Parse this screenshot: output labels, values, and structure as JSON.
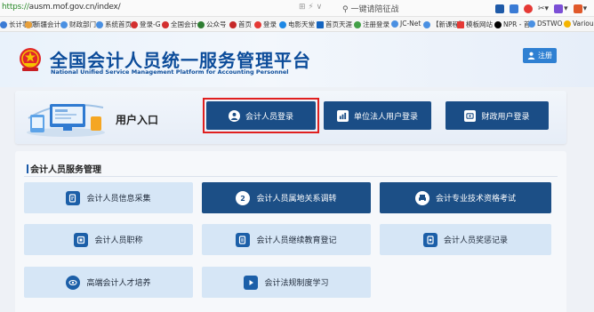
{
  "browser": {
    "url_scheme": "https://",
    "url_rest": "ausm.mof.gov.cn/index/",
    "address_icons": "⊞ ⚡ ∨",
    "search_placeholder": "一键请陪征战",
    "bookmarks": [
      {
        "label": "长计事项",
        "color": "#3a7bd5"
      },
      {
        "label": "新疆会计",
        "color": "#e8a03a"
      },
      {
        "label": "财政部门",
        "color": "#4a90e2"
      },
      {
        "label": "系统首页",
        "color": "#4a90e2"
      },
      {
        "label": "登录-G",
        "color": "#d32f2f"
      },
      {
        "label": "全国会计",
        "color": "#d32f2f"
      },
      {
        "label": "公众号",
        "color": "#2e7d32"
      },
      {
        "label": "首页",
        "color": "#c62828"
      },
      {
        "label": "登录",
        "color": "#e53935"
      },
      {
        "label": "电影天堂",
        "color": "#1e88e5"
      },
      {
        "label": "首页天涯",
        "color": "#1565c0"
      },
      {
        "label": "注册登录",
        "color": "#43a047"
      },
      {
        "label": "JC-Net",
        "color": "#4a90e2"
      },
      {
        "label": "【新课程】",
        "color": "#4a90e2"
      },
      {
        "label": "模板网站",
        "color": "#e53935"
      },
      {
        "label": "NPR - 首",
        "color": "#000000"
      },
      {
        "label": "DSTWO",
        "color": "#4a90e2"
      },
      {
        "label": "Various",
        "color": "#f5b400"
      }
    ]
  },
  "site": {
    "title": "全国会计人员统一服务管理平台",
    "subtitle": "National Unified Service Management Platform for Accounting Personnel",
    "register_label": "注册"
  },
  "entry": {
    "title": "用户入口",
    "accountant_login": "会计人员登录",
    "unit_login": "单位法人用户登录",
    "finance_login": "财政用户登录"
  },
  "services": {
    "title": "会计人员服务管理",
    "items": [
      {
        "label": "会计人员信息采集",
        "icon": "edit-doc-icon"
      },
      {
        "label": "会计人员属地关系调转",
        "icon": "transfer-icon"
      },
      {
        "label": "会计专业技术资格考试",
        "icon": "exam-print-icon"
      },
      {
        "label": "会计人员职称",
        "icon": "certificate-icon"
      },
      {
        "label": "会计人员继续教育登记",
        "icon": "education-register-icon"
      },
      {
        "label": "会计人员奖惩记录",
        "icon": "award-record-icon"
      },
      {
        "label": "高端会计人才培养",
        "icon": "talent-eye-icon"
      },
      {
        "label": "会计法规制度学习",
        "icon": "study-play-icon"
      }
    ]
  },
  "colors": {
    "brand_blue": "#0c4c9a",
    "entry_button": "#1a4d86",
    "service_dark": "#1c4f86",
    "service_light": "#d6e6f6",
    "highlight_red": "#e02020"
  }
}
